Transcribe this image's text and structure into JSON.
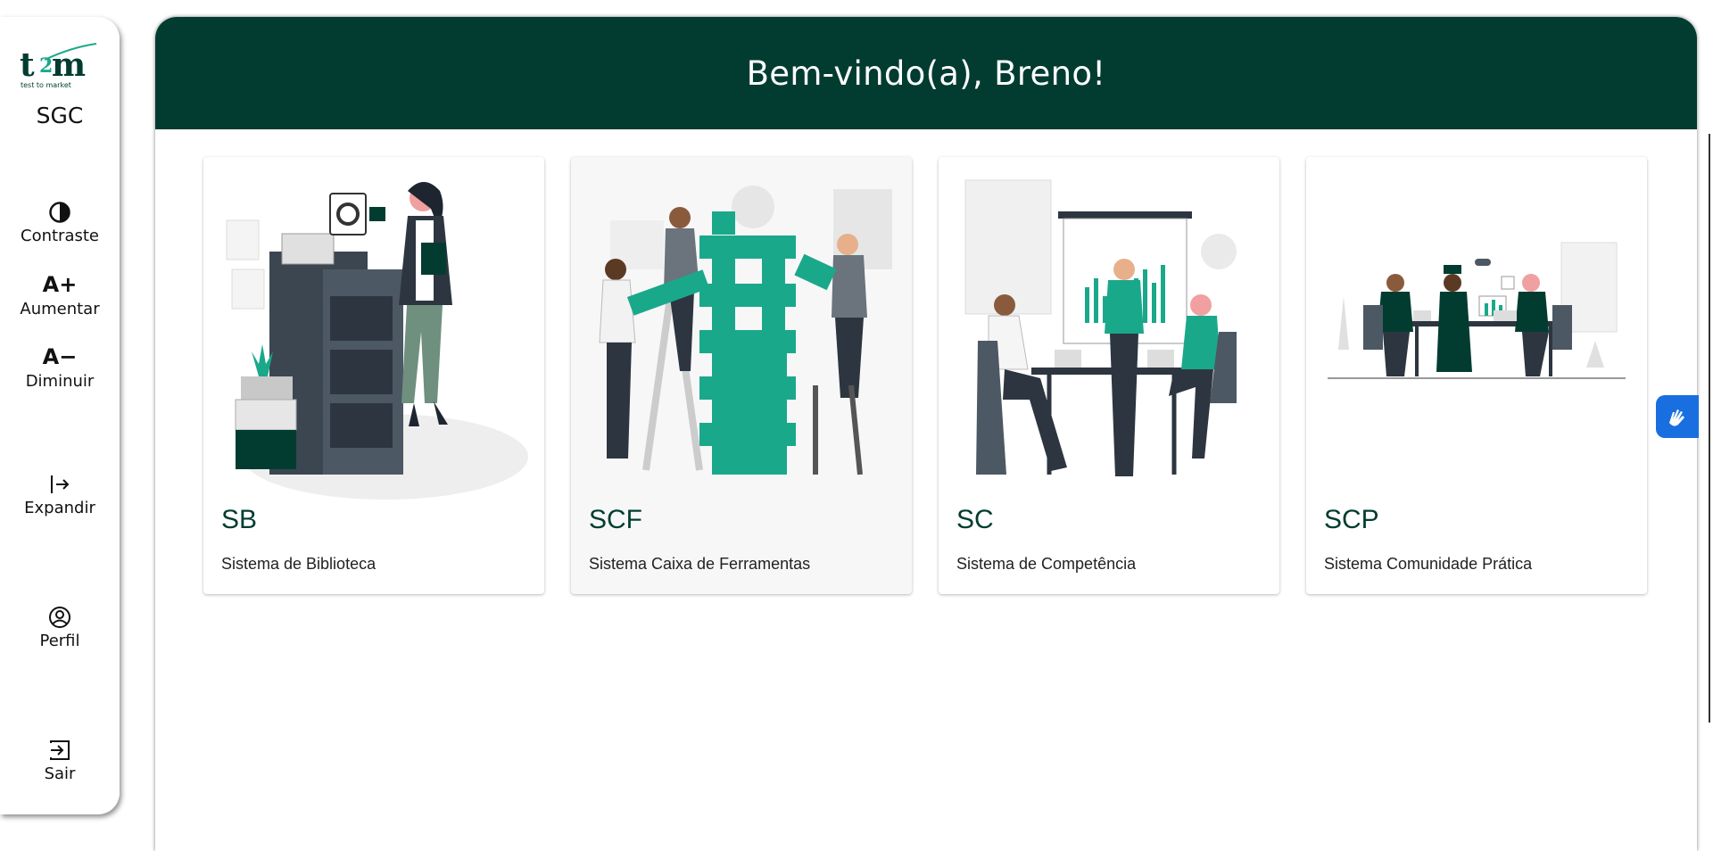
{
  "sidebar": {
    "logo_text": "SGC",
    "logo_mark": "t2m",
    "logo_tagline": "test to market",
    "items": [
      {
        "label": "Contraste",
        "icon": "contrast-icon"
      },
      {
        "label": "Aumentar",
        "icon": "A+"
      },
      {
        "label": "Diminuir",
        "icon": "A−"
      },
      {
        "label": "Expandir",
        "icon": "expand-icon"
      },
      {
        "label": "Perfil",
        "icon": "profile-icon"
      },
      {
        "label": "Sair",
        "icon": "logout-icon"
      }
    ]
  },
  "header": {
    "title": "Bem-vindo(a), Breno!"
  },
  "cards": [
    {
      "code": "SB",
      "description": "Sistema de Biblioteca",
      "illustration": "library-illustration"
    },
    {
      "code": "SCF",
      "description": "Sistema Caixa de Ferramentas",
      "illustration": "toolbox-illustration"
    },
    {
      "code": "SC",
      "description": "Sistema de Competência",
      "illustration": "competency-illustration"
    },
    {
      "code": "SCP",
      "description": "Sistema Comunidade Prática",
      "illustration": "community-illustration"
    }
  ],
  "colors": {
    "primary": "#023c31",
    "accent": "#1aa88b",
    "a11y": "#1a6fe0"
  }
}
